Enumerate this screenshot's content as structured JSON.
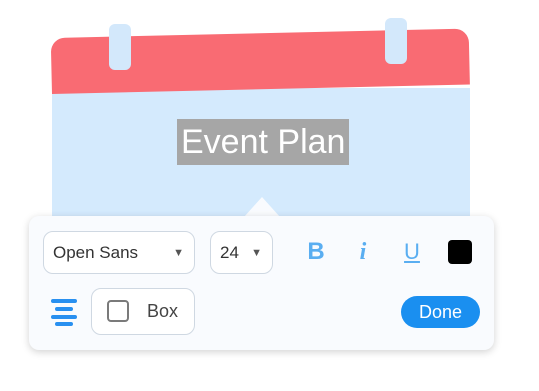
{
  "canvas": {
    "title": "Event Plan"
  },
  "toolbar": {
    "font_family": "Open Sans",
    "font_size": "24",
    "bold_label": "B",
    "italic_label": "i",
    "underline_label": "U",
    "text_color": "#000000",
    "box_label": "Box",
    "box_checked": false,
    "done_label": "Done"
  },
  "colors": {
    "accent": "#1a8ff0",
    "calendar_header": "#f96b73",
    "calendar_body": "#d4eafd"
  },
  "icons": {
    "align": "align-center-icon",
    "dropdown": "chevron-down-icon"
  }
}
